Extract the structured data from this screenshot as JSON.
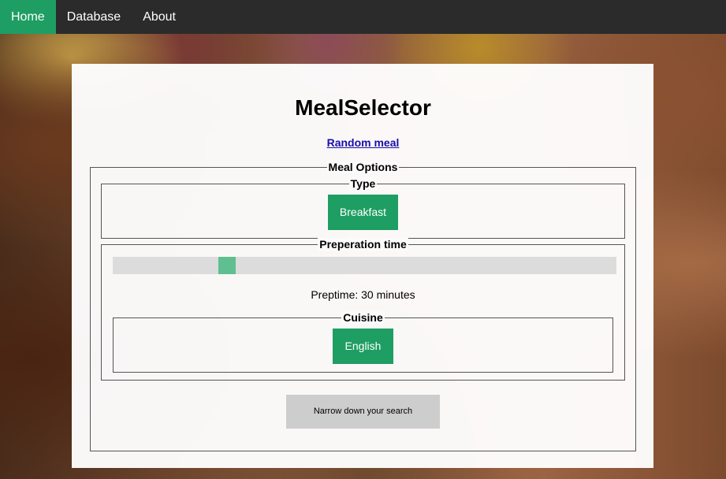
{
  "nav": {
    "items": [
      {
        "label": "Home",
        "active": true
      },
      {
        "label": "Database",
        "active": false
      },
      {
        "label": "About",
        "active": false
      }
    ]
  },
  "title": "MealSelector",
  "random_link": "Random meal",
  "meal_options": {
    "legend": "Meal Options",
    "type": {
      "legend": "Type",
      "button": "Breakfast"
    },
    "prep": {
      "legend": "Preperation time",
      "slider_value_minutes": 30,
      "slider_fraction": 0.23,
      "label": "Preptime: 30 minutes"
    },
    "cuisine": {
      "legend": "Cuisine",
      "button": "English"
    }
  },
  "narrow_button": "Narrow down your search",
  "colors": {
    "accent": "#1e9e63",
    "nav_bg": "#2b2b2b",
    "slider_thumb": "#5fbf91"
  }
}
